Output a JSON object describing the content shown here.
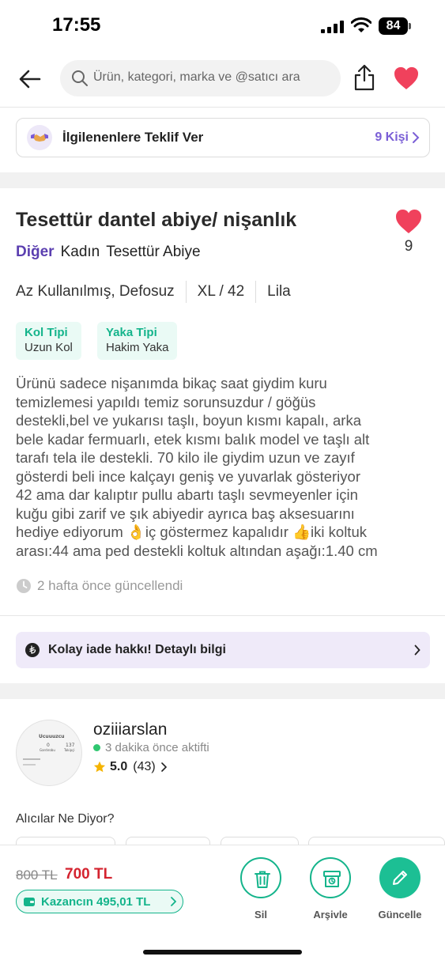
{
  "status_bar": {
    "time": "17:55",
    "battery": "84"
  },
  "header": {
    "search_placeholder": "Ürün, kategori, marka ve @satıcı ara",
    "icons": [
      "back-arrow-icon",
      "search-icon",
      "share-icon",
      "heart-icon"
    ]
  },
  "offer": {
    "label": "İlgilenenlere Teklif Ver",
    "count": "9 Kişi"
  },
  "product": {
    "title": "Tesettür dantel abiye/ nişanlık",
    "favorite_count": "9",
    "categories": [
      "Diğer",
      "Kadın",
      "Tesettür Abiye"
    ],
    "attributes": [
      "Az Kullanılmış, Defosuz",
      "XL / 42",
      "Lila"
    ],
    "tags": [
      {
        "key": "Kol Tipi",
        "value": "Uzun Kol"
      },
      {
        "key": "Yaka Tipi",
        "value": "Hakim Yaka"
      }
    ],
    "description_lines": [
      "Ürünü sadece nişanımda bikaç saat giydim kuru",
      "temizlemesi yapıldı temiz sorunsuzdur / göğüs",
      "destekli,bel ve yukarısı taşlı, boyun kısmı kapalı, arka",
      "bele kadar fermuarlı, etek kısmı balık model ve taşlı alt",
      "tarafı tela ile destekli. 70 kilo ile giydim uzun ve zayıf",
      "gösterdi beli ince kalçayı geniş ve yuvarlak gösteriyor",
      "42 ama dar kalıptır pullu abartı taşlı sevmeyenler için",
      "kuğu gibi zarif ve şık abiyedir ayrıca baş aksesuarını",
      "hediye ediyorum 👌iç göstermez kapalıdır 👍iki koltuk",
      "arası:44 ama ped destekli koltuk altından aşağı:1.40 cm"
    ],
    "updated": "2 hafta önce güncellendi"
  },
  "return_policy": {
    "label": "Kolay iade hakkı! Detaylı bilgi"
  },
  "seller": {
    "name": "oziiiarslan",
    "active": "3 dakika önce aktifti",
    "rating": "5.0",
    "rating_count": "(43)",
    "avatar_text": {
      "name": "Ucuuuzcu",
      "stat1_value": "0",
      "stat1_label": "Gardırobu",
      "stat2_value": "137",
      "stat2_label": "Takipçi"
    }
  },
  "buyers_title": "Alıcılar Ne Diyor?",
  "bottom": {
    "old_price": "800 TL",
    "new_price": "700 TL",
    "earn": "Kazancın 495,01 TL",
    "actions": [
      {
        "label": "Sil",
        "icon": "trash-icon"
      },
      {
        "label": "Arşivle",
        "icon": "archive-icon"
      },
      {
        "label": "Güncelle",
        "icon": "pencil-icon"
      }
    ]
  },
  "colors": {
    "accent_purple": "#5b3fb0",
    "teal": "#14b48b",
    "price_red": "#d4232f",
    "heart": "#f0415c"
  }
}
